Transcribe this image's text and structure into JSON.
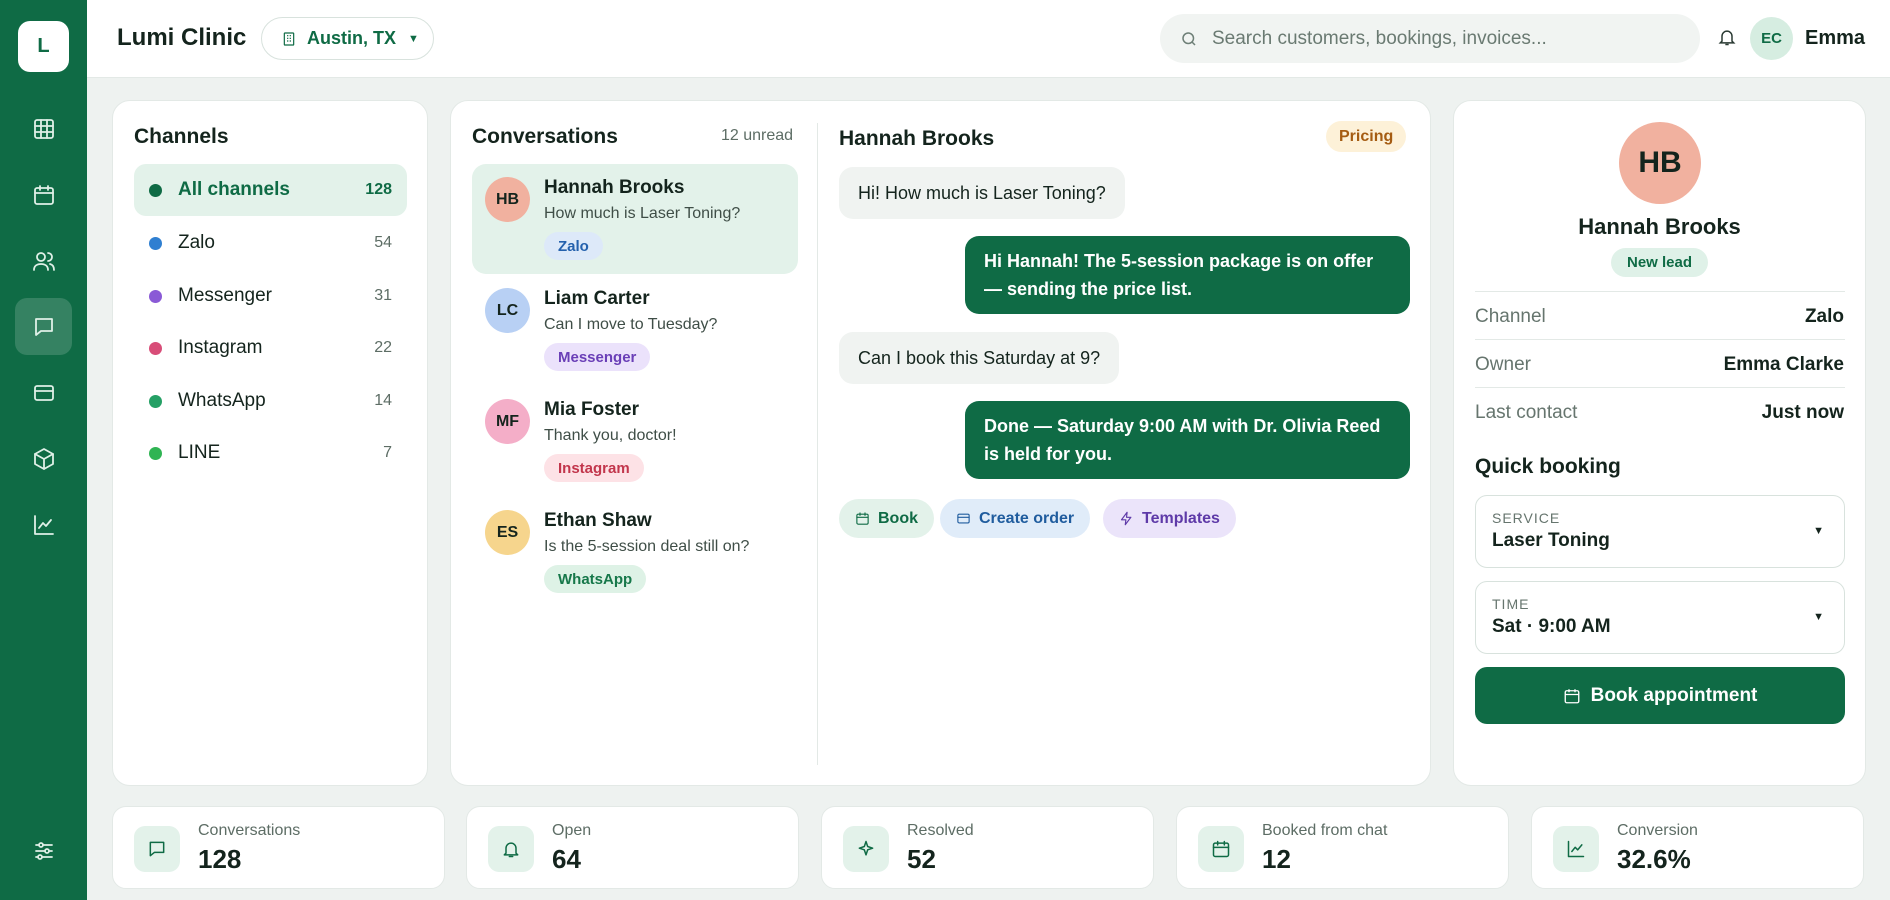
{
  "app": {
    "logo_letter": "L",
    "title": "Lumi Clinic",
    "location": "Austin, TX",
    "search_placeholder": "Search customers, bookings, invoices...",
    "user_initials": "EC",
    "user_name": "Emma"
  },
  "colors": {
    "brand": "#0f6b45",
    "background": "#eef2f0"
  },
  "nav_icons": [
    "grid-icon",
    "calendar-icon",
    "users-icon",
    "chat-icon",
    "card-icon",
    "box-icon",
    "analytics-icon",
    "settings-sliders-icon"
  ],
  "channels": {
    "title": "Channels",
    "items": [
      {
        "name": "All channels",
        "count": "128",
        "color": "#0f6b45"
      },
      {
        "name": "Zalo",
        "count": "54",
        "color": "#2f7fd1"
      },
      {
        "name": "Messenger",
        "count": "31",
        "color": "#8a5ad6"
      },
      {
        "name": "Instagram",
        "count": "22",
        "color": "#d84d78"
      },
      {
        "name": "WhatsApp",
        "count": "14",
        "color": "#25a065"
      },
      {
        "name": "LINE",
        "count": "7",
        "color": "#2fb453"
      }
    ]
  },
  "conversations": {
    "title": "Conversations",
    "unread": "12 unread",
    "items": [
      {
        "initials": "HB",
        "name": "Hannah Brooks",
        "preview": "How much is Laser Toning?",
        "tag": "Zalo",
        "avatar_color": "#f1b19f",
        "tag_bg": "#dde9f9",
        "tag_fg": "#2461ad"
      },
      {
        "initials": "LC",
        "name": "Liam Carter",
        "preview": "Can I move to Tuesday?",
        "tag": "Messenger",
        "avatar_color": "#b8d0f4",
        "tag_bg": "#ebe2fb",
        "tag_fg": "#6a3fb7"
      },
      {
        "initials": "MF",
        "name": "Mia Foster",
        "preview": "Thank you, doctor!",
        "tag": "Instagram",
        "avatar_color": "#f4aec8",
        "tag_bg": "#fde2e6",
        "tag_fg": "#c2364c"
      },
      {
        "initials": "ES",
        "name": "Ethan Shaw",
        "preview": "Is the 5-session deal still on?",
        "tag": "WhatsApp",
        "avatar_color": "#f6d58d",
        "tag_bg": "#def2e6",
        "tag_fg": "#17784a"
      }
    ]
  },
  "chat": {
    "contact": "Hannah Brooks",
    "topic": "Pricing",
    "messages": [
      {
        "direction": "in",
        "text": "Hi! How much is Laser Toning?"
      },
      {
        "direction": "out",
        "text": "Hi Hannah! The 5-session package is on offer — sending the price list."
      },
      {
        "direction": "in",
        "text": "Can I book this Saturday at 9?"
      },
      {
        "direction": "out",
        "text": "Done — Saturday 9:00 AM with Dr. Olivia Reed is held for you."
      }
    ],
    "actions": [
      {
        "label": "Book",
        "icon": "calendar-icon"
      },
      {
        "label": "Create order",
        "icon": "card-icon"
      },
      {
        "label": "Templates",
        "icon": "lightning-icon"
      }
    ]
  },
  "profile": {
    "initials": "HB",
    "name": "Hannah Brooks",
    "status": "New lead",
    "fields": [
      {
        "label": "Channel",
        "value": "Zalo"
      },
      {
        "label": "Owner",
        "value": "Emma Clarke"
      },
      {
        "label": "Last contact",
        "value": "Just now"
      }
    ],
    "quick_booking": {
      "title": "Quick booking",
      "service_label": "SERVICE",
      "service_value": "Laser Toning",
      "time_label": "TIME",
      "time_value": "Sat · 9:00 AM",
      "button": "Book appointment"
    }
  },
  "stats": [
    {
      "label": "Conversations",
      "value": "128",
      "icon": "chat-icon"
    },
    {
      "label": "Open",
      "value": "64",
      "icon": "bell-icon"
    },
    {
      "label": "Resolved",
      "value": "52",
      "icon": "sparkle-icon"
    },
    {
      "label": "Booked from chat",
      "value": "12",
      "icon": "calendar-icon"
    },
    {
      "label": "Conversion",
      "value": "32.6%",
      "icon": "analytics-icon"
    }
  ]
}
